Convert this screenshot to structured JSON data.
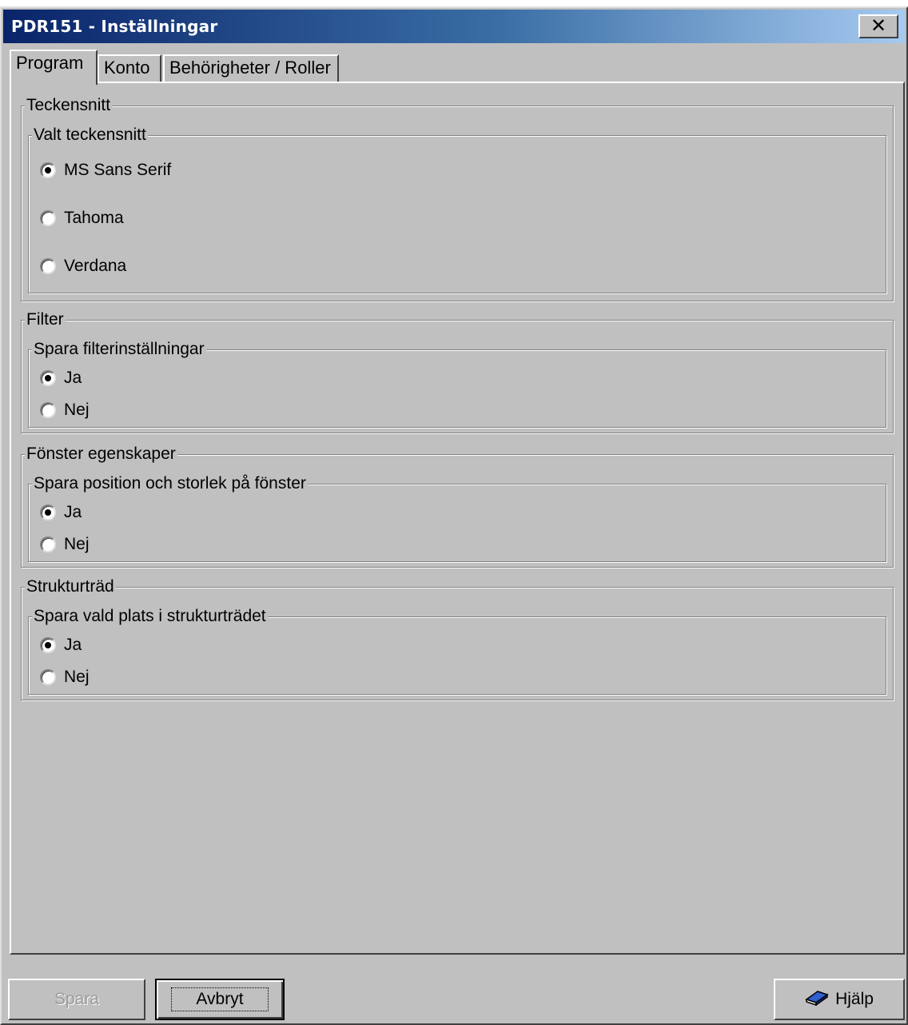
{
  "window": {
    "title": "PDR151 - Inställningar",
    "close_label": "✕"
  },
  "tabs": [
    {
      "label": "Program",
      "active": true
    },
    {
      "label": "Konto",
      "active": false
    },
    {
      "label": "Behörigheter / Roller",
      "active": false
    }
  ],
  "groups": {
    "font": {
      "title": "Teckensnitt",
      "sub_title": "Valt teckensnitt",
      "options": [
        {
          "label": "MS Sans Serif",
          "checked": true
        },
        {
          "label": "Tahoma",
          "checked": false
        },
        {
          "label": "Verdana",
          "checked": false
        }
      ]
    },
    "filter": {
      "title": "Filter",
      "sub_title": "Spara filterinställningar",
      "options": [
        {
          "label": "Ja",
          "checked": true
        },
        {
          "label": "Nej",
          "checked": false
        }
      ]
    },
    "window_props": {
      "title": "Fönster egenskaper",
      "sub_title": "Spara position och storlek på fönster",
      "options": [
        {
          "label": "Ja",
          "checked": true
        },
        {
          "label": "Nej",
          "checked": false
        }
      ]
    },
    "tree": {
      "title": "Strukturträd",
      "sub_title": "Spara vald plats i strukturträdet",
      "options": [
        {
          "label": "Ja",
          "checked": true
        },
        {
          "label": "Nej",
          "checked": false
        }
      ]
    }
  },
  "buttons": {
    "save": "Spara",
    "cancel": "Avbryt",
    "help": "Hjälp",
    "save_disabled": true
  },
  "colors": {
    "face": "#c0c0c0",
    "title_start": "#0a246a",
    "title_end": "#a6caf0"
  },
  "icons": {
    "help": "help-book-icon",
    "close": "close-icon"
  }
}
